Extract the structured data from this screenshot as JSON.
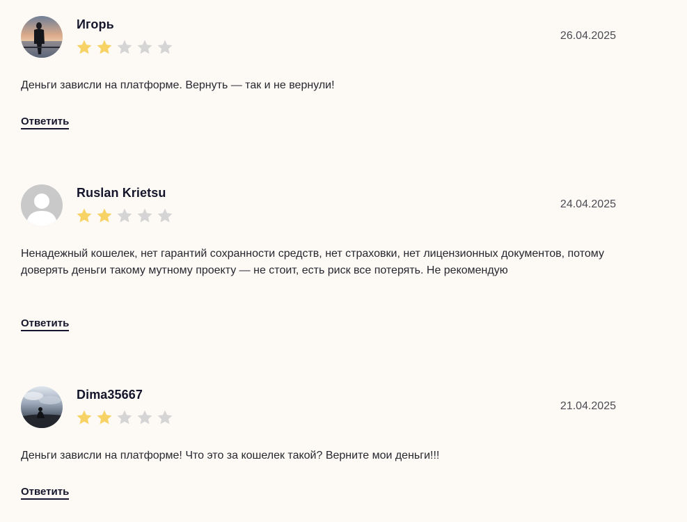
{
  "reviews": [
    {
      "author": "Игорь",
      "date": "26.04.2025",
      "rating": 2,
      "max_rating": 5,
      "text": "Деньги зависли на платформе. Вернуть — так и не вернули!",
      "reply_label": "Ответить",
      "avatar": "photo-person-at-sunset-sea"
    },
    {
      "author": "Ruslan Krietsu",
      "date": "24.04.2025",
      "rating": 2,
      "max_rating": 5,
      "text": "Ненадежный кошелек, нет гарантий сохранности средств, нет страховки, нет лицензионных документов, потому доверять деньги такому мутному проекту — не стоит, есть риск все потерять. Не рекомендую",
      "reply_label": "Ответить",
      "avatar": "default-user-placeholder"
    },
    {
      "author": "Dima35667",
      "date": "21.04.2025",
      "rating": 2,
      "max_rating": 5,
      "text": "Деньги зависли на платформе! Что это за кошелек такой? Верните мои деньги!!!",
      "reply_label": "Ответить",
      "avatar": "photo-person-sitting-under-cloudy-sky"
    }
  ],
  "colors": {
    "background": "#fdfaf6",
    "star_filled": "#f7d264",
    "star_empty": "#d5d5d5",
    "text": "#26272e",
    "heading": "#14152a"
  }
}
